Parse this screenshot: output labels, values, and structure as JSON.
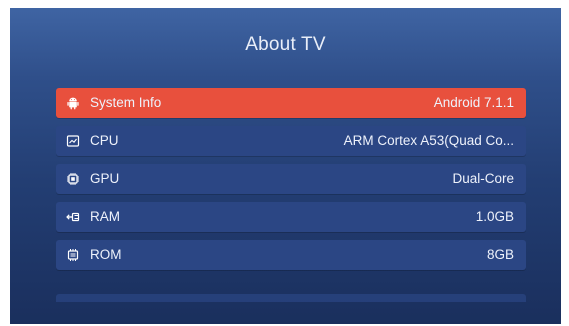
{
  "header": {
    "title": "About TV"
  },
  "items": [
    {
      "icon": "android-icon",
      "label": "System Info",
      "value": "Android 7.1.1",
      "selected": true
    },
    {
      "icon": "cpu-icon",
      "label": "CPU",
      "value": "ARM Cortex A53(Quad Co...",
      "selected": false
    },
    {
      "icon": "gpu-chip-icon",
      "label": "GPU",
      "value": "Dual-Core",
      "selected": false
    },
    {
      "icon": "ram-icon",
      "label": "RAM",
      "value": "1.0GB",
      "selected": false
    },
    {
      "icon": "rom-icon",
      "label": "ROM",
      "value": "8GB",
      "selected": false
    }
  ],
  "colors": {
    "selected": "#e8503d",
    "row": "#2b4684",
    "panel_top": "#3f64a3",
    "panel_bottom": "#1a2f5d",
    "text": "#eef2fb"
  }
}
